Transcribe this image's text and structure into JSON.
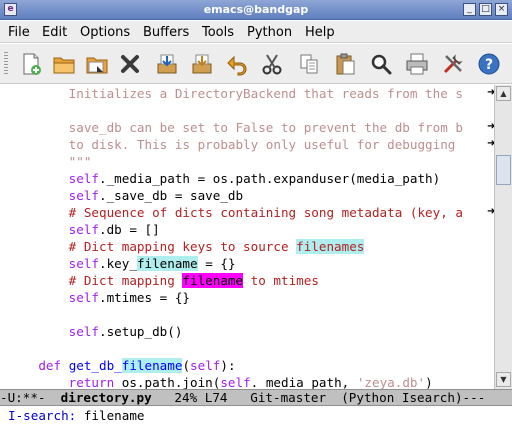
{
  "window": {
    "title": "emacs@bandgap",
    "app_icon": "emacs-icon"
  },
  "menu": [
    "File",
    "Edit",
    "Options",
    "Buffers",
    "Tools",
    "Python",
    "Help"
  ],
  "toolbar_icons": [
    "new-file-icon",
    "open-folder-icon",
    "open-directory-icon",
    "close-buffer-icon",
    "save-icon",
    "save-as-icon",
    "undo-icon",
    "cut-icon",
    "copy-icon",
    "paste-icon",
    "search-icon",
    "print-icon",
    "preferences-icon",
    "help-icon"
  ],
  "code": {
    "l1": "Initializes a DirectoryBackend that reads from the s",
    "l3": "save_db can be set to False to prevent the db from b",
    "l4": "to disk. This is probably only useful for debugging ",
    "l5": "\"\"\"",
    "l6_self": "self",
    "l6_rest": "._media_path = os.path.expanduser(media_path)",
    "l7_self": "self",
    "l7_rest": "._save_db = save_db",
    "l8": "# Sequence of dicts containing song metadata (key, a",
    "l9_self": "self",
    "l9_rest": ".db = []",
    "l10_a": "# Dict mapping keys to source ",
    "l10_match": "filenames",
    "l11_self": "self",
    "l11_a": ".key_",
    "l11_match": "filename",
    "l11_b": " = {}",
    "l12_a": "# Dict mapping ",
    "l12_match": "filename",
    "l12_b": " to mtimes",
    "l13_self": "self",
    "l13_rest": ".mtimes = {}",
    "l15_self": "self",
    "l15_rest": ".setup_db()",
    "l17_def": "def",
    "l17_fn_a": "get_db_",
    "l17_fn_match": "filename",
    "l17_paren": "(",
    "l17_self": "self",
    "l17_end": "):",
    "l18_return": "return",
    "l18_a": " os.path.join(",
    "l18_self": "self",
    "l18_b": "._media_path, ",
    "l18_str": "'zeya.db'",
    "l18_end": ")"
  },
  "modeline": {
    "prefix": "-U:**-  ",
    "buffer": "directory.py",
    "rest": "   24% L74   Git-master  (Python Isearch)---"
  },
  "minibuffer": {
    "prompt": "I-search:",
    "input": " filename"
  }
}
